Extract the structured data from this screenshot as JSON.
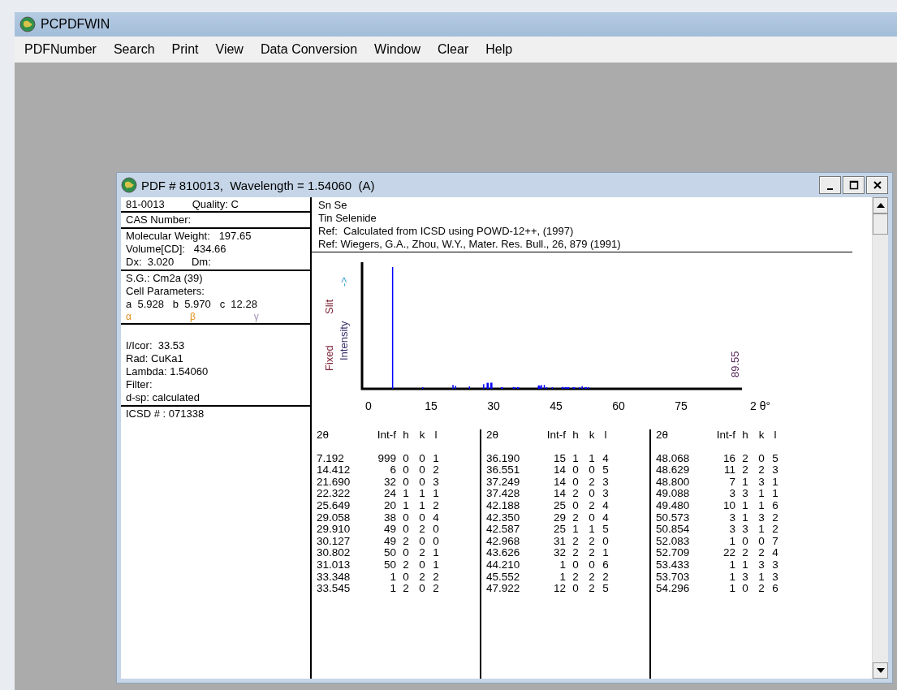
{
  "app": {
    "title": "PCPDFWIN",
    "menu": [
      "PDFNumber",
      "Search",
      "Print",
      "View",
      "Data Conversion",
      "Window",
      "Clear",
      "Help"
    ]
  },
  "card_window": {
    "title": "PDF # 810013,  Wavelength = 1.54060  (A)",
    "left_panel": {
      "pdf_number": "81-0013",
      "quality": "Quality: C",
      "cas": "CAS Number:",
      "physical": [
        "Molecular Weight:   197.65",
        "Volume[CD]:   434.66",
        "Dx:  3.020      Dm:"
      ],
      "cell": [
        "S.G.: Cm2a (39)",
        "Cell Parameters:",
        "a  5.928   b  5.970   c  12.28"
      ],
      "angles": [
        {
          "text": "α",
          "color": "#e0901a"
        },
        {
          "text": "β",
          "color": "#e0901a"
        },
        {
          "text": "γ",
          "color": "#a090b0"
        }
      ],
      "experiment": [
        "I/Icor:  33.53",
        "Rad: CuKa1",
        "Lambda: 1.54060",
        "Filter:",
        "d-sp: calculated"
      ],
      "icsd": "ICSD # : 071338"
    },
    "header": [
      "Sn Se",
      "Tin Selenide",
      "Ref:  Calculated from ICSD using POWD-12++, (1997)",
      "Ref: Wiegers, G.A., Zhou, W.Y., Mater. Res. Bull., 26, 879 (1991)"
    ],
    "pattern": {
      "y_label": [
        {
          "text": "Fixed",
          "color": "#7a1f33"
        },
        {
          "text": "Slit",
          "color": "#7a1f33"
        },
        {
          "text": "Intensity",
          "color": "#3b2f6a"
        },
        {
          "text": "->",
          "color": "#3aa0c8"
        }
      ],
      "x_ticks": [
        "0",
        "15",
        "30",
        "45",
        "60",
        "75"
      ],
      "x_unit": "2 θ°",
      "max_label": "89.55"
    },
    "peak_table": [
      {
        "columns": [
          "2θ",
          "Int-f",
          "h",
          "k",
          "l"
        ],
        "rows": [
          [
            "7.192",
            "999",
            "0",
            "0",
            "1"
          ],
          [
            "14.412",
            "6",
            "0",
            "0",
            "2"
          ],
          [
            "21.690",
            "32",
            "0",
            "0",
            "3"
          ],
          [
            "22.322",
            "24",
            "1",
            "1",
            "1"
          ],
          [
            "25.649",
            "20",
            "1",
            "1",
            "2"
          ],
          [
            "29.058",
            "38",
            "0",
            "0",
            "4"
          ],
          [
            "29.910",
            "49",
            "0",
            "2",
            "0"
          ],
          [
            "30.127",
            "49",
            "2",
            "0",
            "0"
          ],
          [
            "30.802",
            "50",
            "0",
            "2",
            "1"
          ],
          [
            "31.013",
            "50",
            "2",
            "0",
            "1"
          ],
          [
            "33.348",
            "1",
            "0",
            "2",
            "2"
          ],
          [
            "33.545",
            "1",
            "2",
            "0",
            "2"
          ]
        ]
      },
      {
        "columns": [
          "2θ",
          "Int-f",
          "h",
          "k",
          "l"
        ],
        "rows": [
          [
            "36.190",
            "15",
            "1",
            "1",
            "4"
          ],
          [
            "36.551",
            "14",
            "0",
            "0",
            "5"
          ],
          [
            "37.249",
            "14",
            "0",
            "2",
            "3"
          ],
          [
            "37.428",
            "14",
            "2",
            "0",
            "3"
          ],
          [
            "42.188",
            "25",
            "0",
            "2",
            "4"
          ],
          [
            "42.350",
            "29",
            "2",
            "0",
            "4"
          ],
          [
            "42.587",
            "25",
            "1",
            "1",
            "5"
          ],
          [
            "42.968",
            "31",
            "2",
            "2",
            "0"
          ],
          [
            "43.626",
            "32",
            "2",
            "2",
            "1"
          ],
          [
            "44.210",
            "1",
            "0",
            "0",
            "6"
          ],
          [
            "45.552",
            "1",
            "2",
            "2",
            "2"
          ],
          [
            "47.922",
            "12",
            "0",
            "2",
            "5"
          ]
        ]
      },
      {
        "columns": [
          "2θ",
          "Int-f",
          "h",
          "k",
          "l"
        ],
        "rows": [
          [
            "48.068",
            "16",
            "2",
            "0",
            "5"
          ],
          [
            "48.629",
            "11",
            "2",
            "2",
            "3"
          ],
          [
            "48.800",
            "7",
            "1",
            "3",
            "1"
          ],
          [
            "49.088",
            "3",
            "3",
            "1",
            "1"
          ],
          [
            "49.480",
            "10",
            "1",
            "1",
            "6"
          ],
          [
            "50.573",
            "3",
            "1",
            "3",
            "2"
          ],
          [
            "50.854",
            "3",
            "3",
            "1",
            "2"
          ],
          [
            "52.083",
            "1",
            "0",
            "0",
            "7"
          ],
          [
            "52.709",
            "22",
            "2",
            "2",
            "4"
          ],
          [
            "53.433",
            "1",
            "1",
            "3",
            "3"
          ],
          [
            "53.703",
            "1",
            "3",
            "1",
            "3"
          ],
          [
            "54.296",
            "1",
            "0",
            "2",
            "6"
          ]
        ]
      }
    ]
  }
}
